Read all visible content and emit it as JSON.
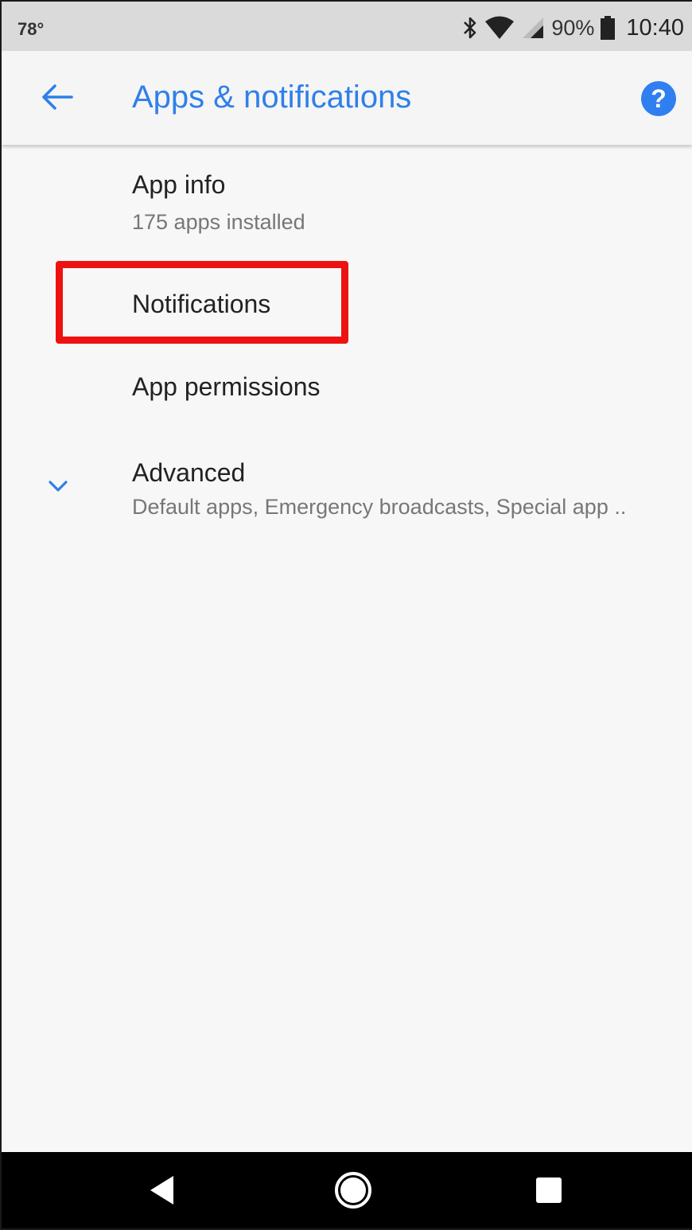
{
  "status_bar": {
    "temperature": "78°",
    "battery": "90%",
    "time": "10:40"
  },
  "app_bar": {
    "title": "Apps & notifications"
  },
  "list": [
    {
      "title": "App info",
      "subtitle": "175 apps installed"
    },
    {
      "title": "Notifications",
      "highlighted": true
    },
    {
      "title": "App permissions"
    },
    {
      "title": "Advanced",
      "subtitle": "Default apps, Emergency broadcasts, Special app ..",
      "icon": "chevron-down-icon"
    }
  ],
  "icons": {
    "back": "arrow-left-icon",
    "help": "help-circle-icon",
    "bluetooth": "bluetooth-icon",
    "wifi": "wifi-icon",
    "signal": "cell-signal-icon",
    "battery": "battery-icon",
    "nav_back": "nav-back-icon",
    "nav_home": "nav-home-icon",
    "nav_recents": "nav-recents-icon"
  },
  "colors": {
    "accent": "#2f80e8",
    "highlight": "#ee1111",
    "status_bar_bg": "#dadada",
    "nav_bar_bg": "#000000"
  }
}
